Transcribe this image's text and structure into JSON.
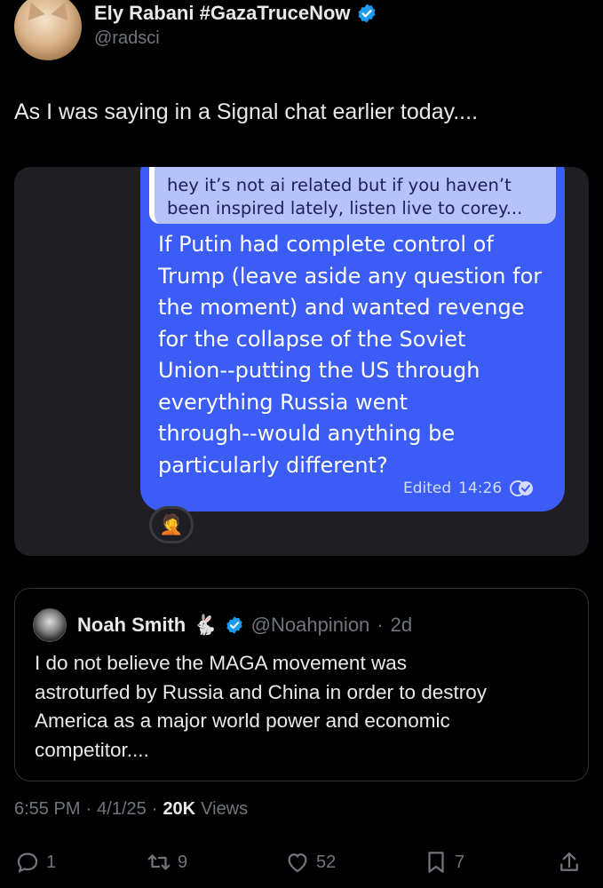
{
  "author": {
    "display_name": "Ely Rabani #GazaTruceNow",
    "handle": "@radsci",
    "avatar_icon": "cat-avatar",
    "verified_color": "#1d9bf0"
  },
  "tweet": {
    "text": "As I was saying in a Signal chat earlier today...."
  },
  "signal_screenshot": {
    "quoted_message_lines": [
      "hey it’s not ai related but if you haven’t",
      "been inspired lately, listen live to corey..."
    ],
    "message_lines": [
      "If Putin had complete control of",
      "Trump (leave aside any question for",
      "the moment) and wanted revenge",
      "for the collapse of the Soviet",
      "Union--putting the US through",
      "everything Russia went",
      "through--would anything be",
      "particularly different?"
    ],
    "edited_label": "Edited",
    "time": "14:26",
    "reaction": "🤦",
    "bubble_color": "#3b5cf5"
  },
  "quoted_tweet": {
    "display_name": "Noah Smith",
    "emoji": "🐇",
    "handle": "@Noahpinion",
    "separator": "·",
    "age": "2d",
    "text_lines": [
      "I do not believe the MAGA movement was",
      "astroturfed by Russia and China in order to destroy",
      "America as a major world power and economic",
      "competitor...."
    ]
  },
  "meta": {
    "time": "6:55 PM",
    "date": "4/1/25",
    "views_count": "20K",
    "views_label": "Views",
    "separator": "·"
  },
  "actions": {
    "replies": "1",
    "retweets": "9",
    "likes": "52",
    "bookmarks": "7"
  }
}
